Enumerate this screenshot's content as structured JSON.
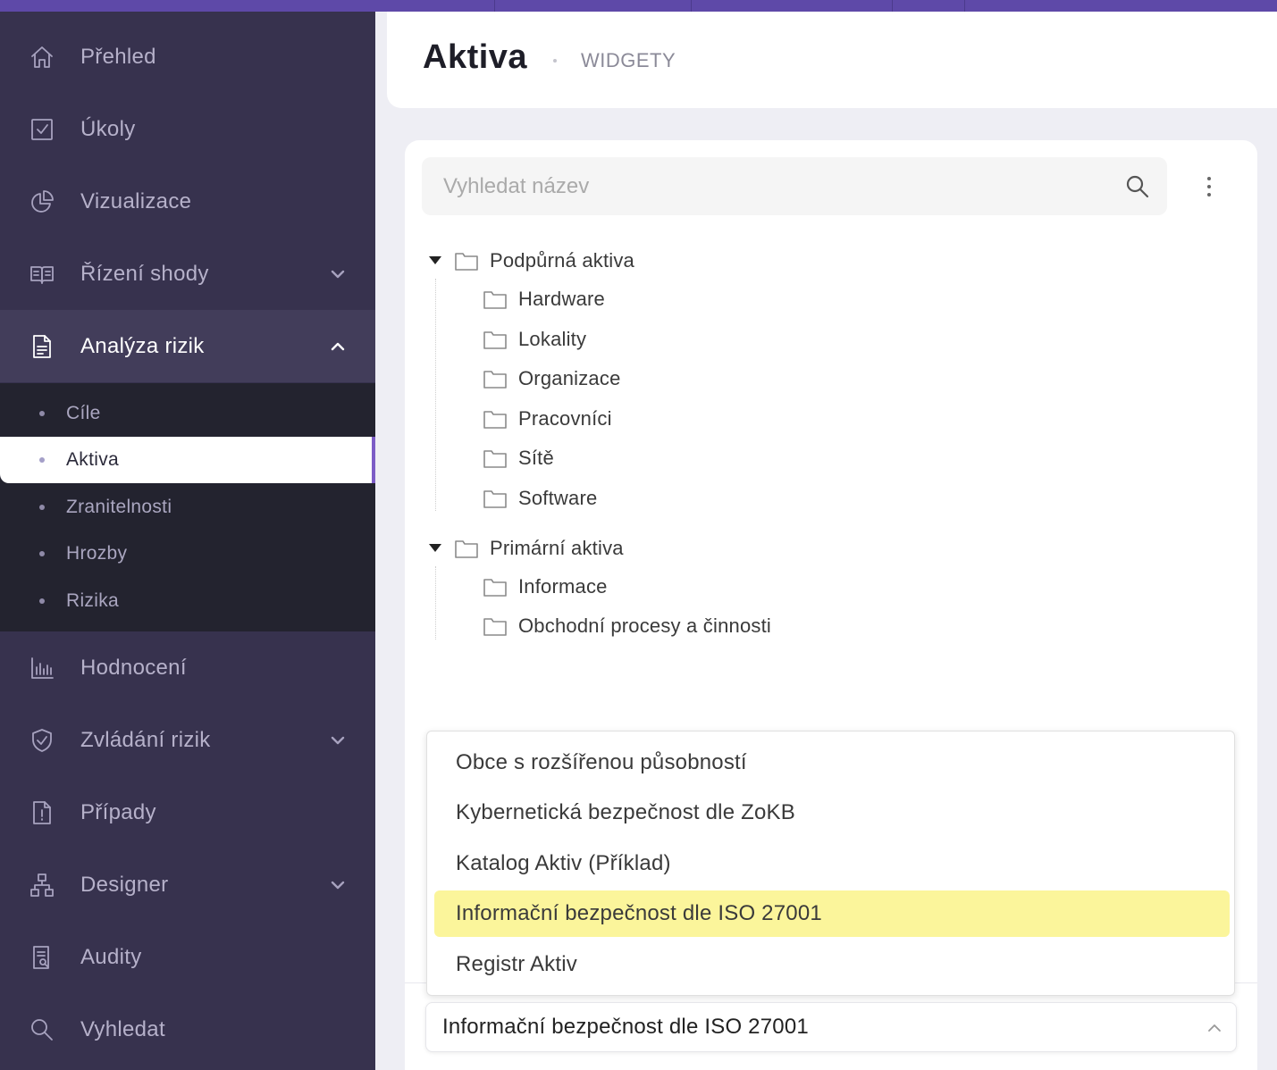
{
  "colors": {
    "sidebar_bg": "#37324e",
    "submenu_bg": "#23232f",
    "accent": "#7c5cc6",
    "top_strip": "#5e49a8",
    "highlight": "#fbf59b"
  },
  "sidebar": {
    "items": [
      {
        "label": "Přehled",
        "icon": "home-icon"
      },
      {
        "label": "Úkoly",
        "icon": "checkbox-icon"
      },
      {
        "label": "Vizualizace",
        "icon": "pie-chart-icon"
      },
      {
        "label": "Řízení shody",
        "icon": "book-icon",
        "expandable": true
      },
      {
        "label": "Analýza rizik",
        "icon": "document-icon",
        "expanded": true,
        "active": true
      },
      {
        "label": "Hodnocení",
        "icon": "bar-chart-icon"
      },
      {
        "label": "Zvládání rizik",
        "icon": "shield-check-icon",
        "expandable": true
      },
      {
        "label": "Případy",
        "icon": "document-alert-icon"
      },
      {
        "label": "Designer",
        "icon": "hierarchy-icon",
        "expandable": true
      },
      {
        "label": "Audity",
        "icon": "audit-icon"
      },
      {
        "label": "Vyhledat",
        "icon": "search-icon"
      }
    ],
    "submenu": [
      {
        "label": "Cíle"
      },
      {
        "label": "Aktiva",
        "active": true
      },
      {
        "label": "Zranitelnosti"
      },
      {
        "label": "Hrozby"
      },
      {
        "label": "Rizika"
      }
    ]
  },
  "header": {
    "title": "Aktiva",
    "breadcrumb": "WIDGETY"
  },
  "search": {
    "placeholder": "Vyhledat název",
    "value": ""
  },
  "tree": [
    {
      "label": "Podpůrná aktiva",
      "expanded": true,
      "children": [
        "Hardware",
        "Lokality",
        "Organizace",
        "Pracovníci",
        "Sítě",
        "Software"
      ]
    },
    {
      "label": "Primární aktiva",
      "expanded": true,
      "children": [
        "Informace",
        "Obchodní procesy a činnosti"
      ]
    }
  ],
  "dropdown": {
    "options": [
      "Obce s rozšířenou působností",
      "Kybernetická bezpečnost dle ZoKB",
      "Katalog Aktiv (Příklad)",
      "Informační bezpečnost dle ISO 27001",
      "Registr Aktiv"
    ],
    "highlighted_index": 3,
    "selected": "Informační bezpečnost dle ISO 27001"
  }
}
